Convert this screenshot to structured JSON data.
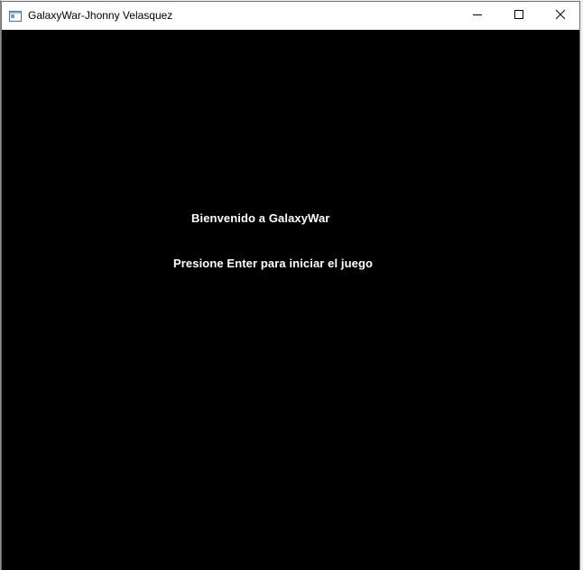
{
  "window": {
    "title": "GalaxyWar-Jhonny Velasquez",
    "icon": "app-window-icon",
    "controls": {
      "minimize": "minimize-icon",
      "maximize": "maximize-icon",
      "close": "close-icon"
    }
  },
  "game": {
    "background_color": "#000000",
    "text_color": "#ffffff",
    "welcome_text": "Bienvenido a GalaxyWar",
    "prompt_text": "Presione Enter para iniciar el juego"
  }
}
